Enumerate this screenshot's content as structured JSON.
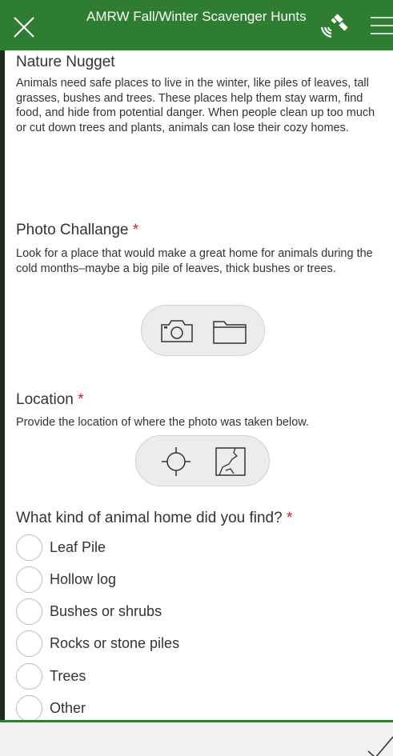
{
  "header": {
    "title": "AMRW Fall/Winter Scavenger Hunts",
    "close_icon": "close-icon",
    "gps_icon": "gps-satellite-icon",
    "menu_icon": "hamburger-menu-icon",
    "background_color": "#2e7d32"
  },
  "nature_nugget": {
    "heading": "Nature Nugget",
    "body": "Animals need safe places to live in the winter, like piles of leaves, tall grasses, bushes and trees. These places help them stay warm, find food, and hide from potential danger. When people clean up too much or cut down trees and plants, animals can lose their cozy homes."
  },
  "photo": {
    "heading": "Photo Challange",
    "required_mark": "*",
    "hint": "Look for a place that would make a great home for animals during the cold months–maybe a big pile of leaves, thick bushes or trees.",
    "camera_icon": "camera-icon",
    "folder_icon": "folder-icon"
  },
  "location": {
    "heading": "Location",
    "required_mark": "*",
    "hint": "Provide the location of where the photo was taken below.",
    "crosshair_icon": "crosshair-icon",
    "map_icon": "map-icon"
  },
  "animal_home": {
    "question": "What kind of animal home did you find?",
    "required_mark": "*",
    "options": [
      {
        "label": "Leaf Pile"
      },
      {
        "label": "Hollow log"
      },
      {
        "label": "Bushes or shrubs"
      },
      {
        "label": "Rocks or stone piles"
      },
      {
        "label": "Trees"
      },
      {
        "label": "Other"
      }
    ]
  },
  "footer": {
    "submit_icon": "checkmark-icon",
    "accent_color": "#2e7d32"
  }
}
